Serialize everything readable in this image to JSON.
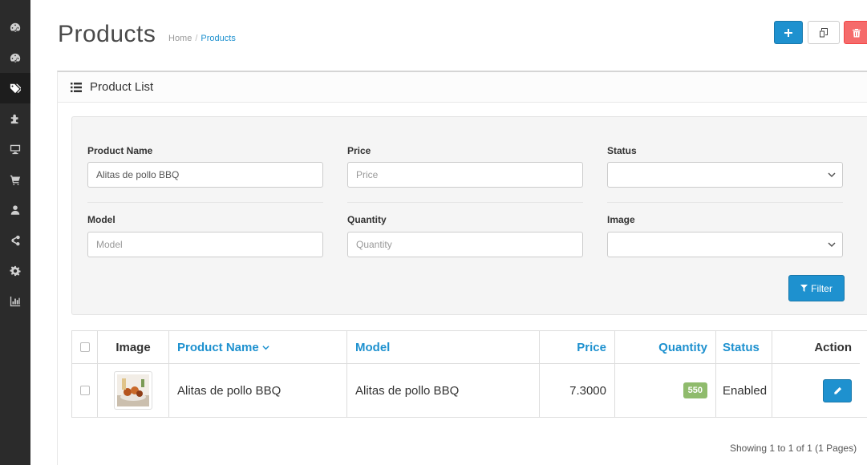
{
  "header": {
    "title": "Products",
    "breadcrumb": [
      {
        "label": "Home"
      },
      {
        "label": "Products"
      }
    ]
  },
  "icons": {
    "sidebar": [
      "dashboard-icon",
      "dashboard-icon",
      "tags-icon",
      "puzzle-icon",
      "desktop-icon",
      "cart-icon",
      "user-icon",
      "share-icon",
      "cog-icon",
      "bar-chart-icon"
    ],
    "add": "plus-icon",
    "copy": "copy-icon",
    "delete": "trash-icon",
    "panel": "list-icon",
    "filter": "filter-icon",
    "edit": "pencil-icon"
  },
  "colors": {
    "primary": "#1e91cf",
    "danger": "#f56b6b",
    "success": "#8fbb6c",
    "sidebar": "#2b2b2b"
  },
  "panel": {
    "title": "Product List"
  },
  "filter": {
    "product_name_label": "Product Name",
    "product_name_value": "Alitas de pollo BBQ",
    "price_label": "Price",
    "price_placeholder": "Price",
    "status_label": "Status",
    "model_label": "Model",
    "model_placeholder": "Model",
    "quantity_label": "Quantity",
    "quantity_placeholder": "Quantity",
    "image_label": "Image",
    "button_label": "Filter"
  },
  "table": {
    "columns": {
      "image": "Image",
      "product_name": "Product Name",
      "model": "Model",
      "price": "Price",
      "quantity": "Quantity",
      "status": "Status",
      "action": "Action"
    },
    "rows": [
      {
        "product_name": "Alitas de pollo BBQ",
        "model": "Alitas de pollo BBQ",
        "price": "7.3000",
        "quantity": "550",
        "status": "Enabled"
      }
    ]
  },
  "pagination": {
    "info": "Showing 1 to 1 of 1 (1 Pages)"
  }
}
